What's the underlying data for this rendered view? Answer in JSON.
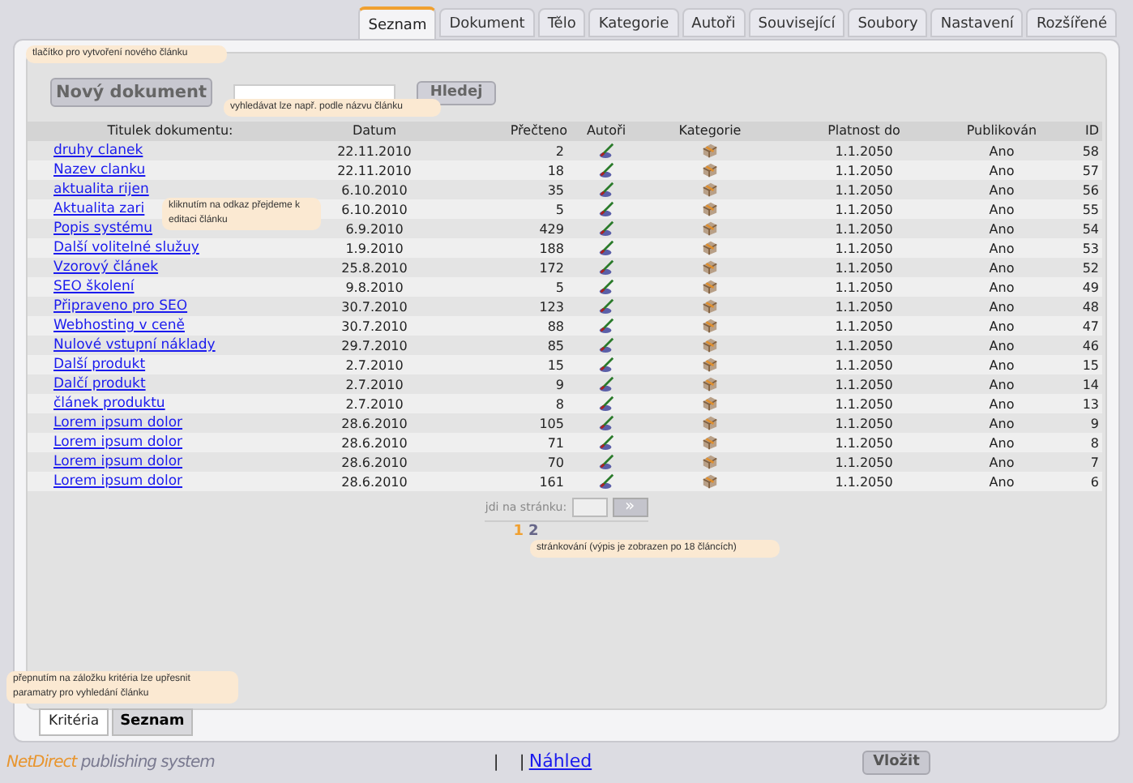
{
  "tabs": [
    {
      "label": "Seznam",
      "selected": true
    },
    {
      "label": "Dokument",
      "selected": false
    },
    {
      "label": "Tělo",
      "selected": false
    },
    {
      "label": "Kategorie",
      "selected": false
    },
    {
      "label": "Autoři",
      "selected": false
    },
    {
      "label": "Související",
      "selected": false
    },
    {
      "label": "Soubory",
      "selected": false
    },
    {
      "label": "Nastavení",
      "selected": false
    },
    {
      "label": "Rozšířené",
      "selected": false
    }
  ],
  "new_button": "Nový dokument",
  "search_button": "Hledej",
  "table": {
    "columns": [
      "Titulek dokumentu:",
      "Datum",
      "Přečteno",
      "Autoři",
      "Kategorie",
      "Platnost do",
      "Publikován",
      "ID"
    ],
    "rows": [
      {
        "title": "druhy clanek",
        "date": "22.11.2010",
        "reads": "2",
        "valid_to": "1.1.2050",
        "published": "Ano",
        "id": "58"
      },
      {
        "title": "Nazev clanku",
        "date": "22.11.2010",
        "reads": "18",
        "valid_to": "1.1.2050",
        "published": "Ano",
        "id": "57"
      },
      {
        "title": "aktualita rijen",
        "date": "6.10.2010",
        "reads": "35",
        "valid_to": "1.1.2050",
        "published": "Ano",
        "id": "56"
      },
      {
        "title": "Aktualita zari",
        "date": "6.10.2010",
        "reads": "5",
        "valid_to": "1.1.2050",
        "published": "Ano",
        "id": "55"
      },
      {
        "title": "Popis systému",
        "date": "6.9.2010",
        "reads": "429",
        "valid_to": "1.1.2050",
        "published": "Ano",
        "id": "54"
      },
      {
        "title": "Další volitelné služuy",
        "date": "1.9.2010",
        "reads": "188",
        "valid_to": "1.1.2050",
        "published": "Ano",
        "id": "53"
      },
      {
        "title": "Vzorový článek",
        "date": "25.8.2010",
        "reads": "172",
        "valid_to": "1.1.2050",
        "published": "Ano",
        "id": "52"
      },
      {
        "title": "SEO školení",
        "date": "9.8.2010",
        "reads": "5",
        "valid_to": "1.1.2050",
        "published": "Ano",
        "id": "49"
      },
      {
        "title": "Připraveno pro SEO",
        "date": "30.7.2010",
        "reads": "123",
        "valid_to": "1.1.2050",
        "published": "Ano",
        "id": "48"
      },
      {
        "title": "Webhosting v ceně",
        "date": "30.7.2010",
        "reads": "88",
        "valid_to": "1.1.2050",
        "published": "Ano",
        "id": "47"
      },
      {
        "title": "Nulové vstupní náklady",
        "date": "29.7.2010",
        "reads": "85",
        "valid_to": "1.1.2050",
        "published": "Ano",
        "id": "46"
      },
      {
        "title": "Další produkt",
        "date": "2.7.2010",
        "reads": "15",
        "valid_to": "1.1.2050",
        "published": "Ano",
        "id": "15"
      },
      {
        "title": "Dalčí produkt",
        "date": "2.7.2010",
        "reads": "9",
        "valid_to": "1.1.2050",
        "published": "Ano",
        "id": "14"
      },
      {
        "title": "článek produktu",
        "date": "2.7.2010",
        "reads": "8",
        "valid_to": "1.1.2050",
        "published": "Ano",
        "id": "13"
      },
      {
        "title": "Lorem ipsum dolor",
        "date": "28.6.2010",
        "reads": "105",
        "valid_to": "1.1.2050",
        "published": "Ano",
        "id": "9"
      },
      {
        "title": "Lorem ipsum dolor",
        "date": "28.6.2010",
        "reads": "71",
        "valid_to": "1.1.2050",
        "published": "Ano",
        "id": "8"
      },
      {
        "title": "Lorem ipsum dolor",
        "date": "28.6.2010",
        "reads": "70",
        "valid_to": "1.1.2050",
        "published": "Ano",
        "id": "7"
      },
      {
        "title": "Lorem ipsum dolor",
        "date": "28.6.2010",
        "reads": "161",
        "valid_to": "1.1.2050",
        "published": "Ano",
        "id": "6"
      }
    ]
  },
  "pager": {
    "label": "jdi na stránku:",
    "go_button": "»",
    "pages": [
      {
        "label": "1",
        "selected": true
      },
      {
        "label": "2",
        "selected": false
      }
    ]
  },
  "hints": [
    "tlačítko pro vytvoření nového článku",
    "vyhledávat lze např. podle názvu článku",
    "kliknutím na odkaz přejdeme k editaci článku",
    "stránkování (výpis je zobrazen po 18 článcích)",
    "přepnutím na záložku kritéria lze upřesnit paramatry pro vyhledání článku"
  ],
  "bottom_tabs": [
    {
      "label": "Kritéria",
      "selected": false
    },
    {
      "label": "Seznam",
      "selected": true
    }
  ],
  "footer": {
    "logo_brand": "NetDirect",
    "logo_tagline": "publishing system",
    "separators": [
      "|",
      "|"
    ],
    "preview_link": "Náhled",
    "insert_button": "Vložit"
  }
}
